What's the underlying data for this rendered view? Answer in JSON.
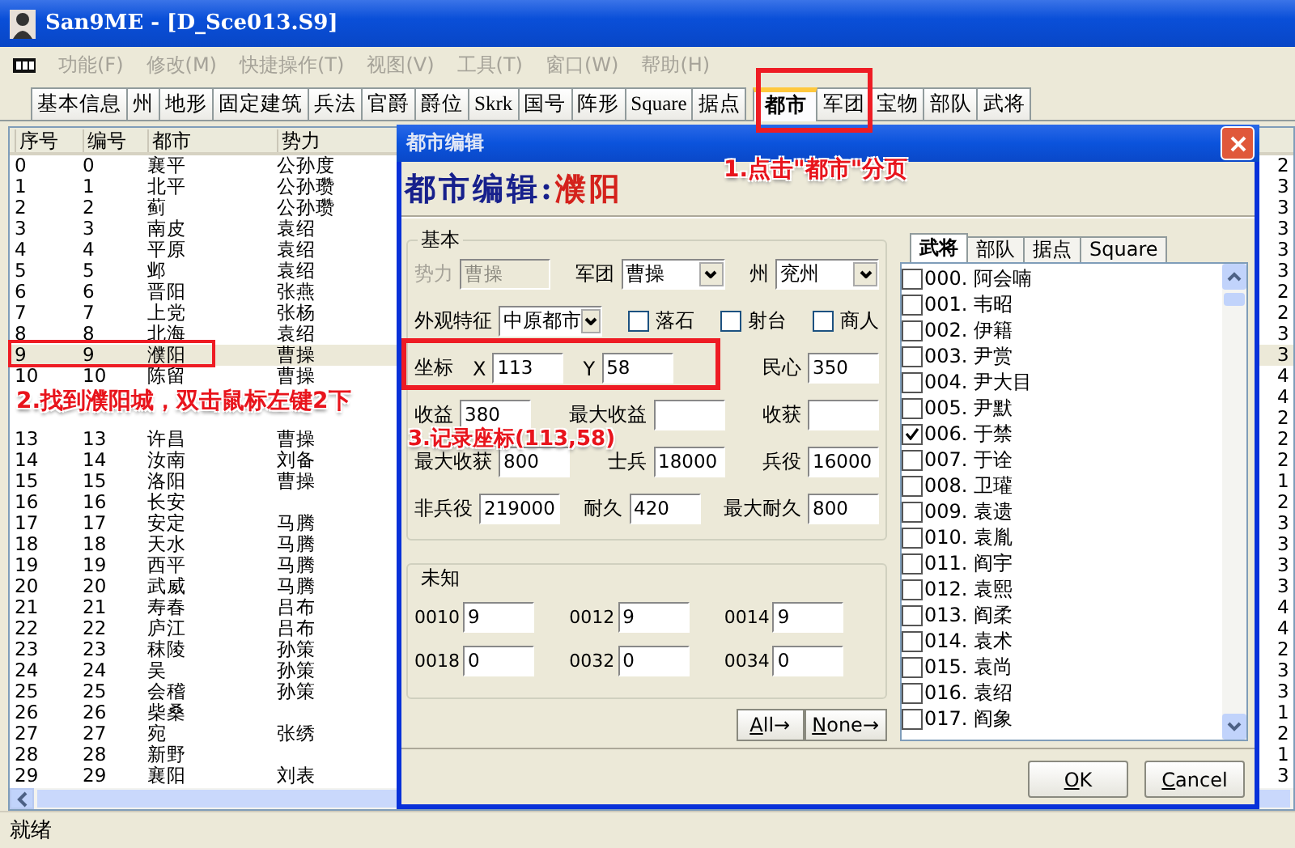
{
  "window": {
    "title": "San9ME - [D_Sce013.S9]"
  },
  "menu": [
    {
      "label": "功能(F)",
      "disabled": true
    },
    {
      "label": "修改(M)",
      "disabled": true
    },
    {
      "label": "快捷操作(T)",
      "disabled": true
    },
    {
      "label": "视图(V)",
      "disabled": true
    },
    {
      "label": "工具(T)",
      "disabled": true
    },
    {
      "label": "窗口(W)",
      "disabled": true
    },
    {
      "label": "帮助(H)",
      "disabled": true
    }
  ],
  "tabs": [
    {
      "label": "基本信息",
      "selected": false
    },
    {
      "label": "州",
      "selected": false
    },
    {
      "label": "地形",
      "selected": false
    },
    {
      "label": "固定建筑",
      "selected": false
    },
    {
      "label": "兵法",
      "selected": false
    },
    {
      "label": "官爵",
      "selected": false
    },
    {
      "label": "爵位",
      "selected": false
    },
    {
      "label": "Skrk",
      "selected": false
    },
    {
      "label": "国号",
      "selected": false
    },
    {
      "label": "阵形",
      "selected": false
    },
    {
      "label": "Square",
      "selected": false
    },
    {
      "label": "据点",
      "selected": false
    },
    {
      "label": "都市",
      "selected": true
    },
    {
      "label": "军团",
      "selected": false
    },
    {
      "label": "宝物",
      "selected": false
    },
    {
      "label": "部队",
      "selected": false
    },
    {
      "label": "武将",
      "selected": false
    }
  ],
  "city_list": {
    "columns": [
      "序号",
      "编号",
      "都市",
      "势力"
    ],
    "rows": [
      {
        "no": "0",
        "id": "0",
        "city": "襄平",
        "faction": "公孙度",
        "column_5": "2",
        "selected": false
      },
      {
        "no": "1",
        "id": "1",
        "city": "北平",
        "faction": "公孙瓒",
        "column_5": "3",
        "selected": false
      },
      {
        "no": "2",
        "id": "2",
        "city": "蓟",
        "faction": "公孙瓒",
        "column_5": "3",
        "selected": false
      },
      {
        "no": "3",
        "id": "3",
        "city": "南皮",
        "faction": "袁绍",
        "column_5": "3",
        "selected": false
      },
      {
        "no": "4",
        "id": "4",
        "city": "平原",
        "faction": "袁绍",
        "column_5": "3",
        "selected": false
      },
      {
        "no": "5",
        "id": "5",
        "city": "邺",
        "faction": "袁绍",
        "column_5": "3",
        "selected": false
      },
      {
        "no": "6",
        "id": "6",
        "city": "晋阳",
        "faction": "张燕",
        "column_5": "2",
        "selected": false
      },
      {
        "no": "7",
        "id": "7",
        "city": "上党",
        "faction": "张杨",
        "column_5": "2",
        "selected": false
      },
      {
        "no": "8",
        "id": "8",
        "city": "北海",
        "faction": "袁绍",
        "column_5": "3",
        "selected": false
      },
      {
        "no": "9",
        "id": "9",
        "city": "濮阳",
        "faction": "曹操",
        "column_5": "3",
        "selected": true
      },
      {
        "no": "10",
        "id": "10",
        "city": "陈留",
        "faction": "曹操",
        "column_5": "4",
        "selected": false
      },
      {
        "column_5": "4",
        "selected": false
      },
      {
        "column_5": "2",
        "selected": false
      },
      {
        "no": "13",
        "id": "13",
        "city": "许昌",
        "faction": "曹操",
        "column_5": "2",
        "selected": false
      },
      {
        "no": "14",
        "id": "14",
        "city": "汝南",
        "faction": "刘备",
        "column_5": "2",
        "selected": false
      },
      {
        "no": "15",
        "id": "15",
        "city": "洛阳",
        "faction": "曹操",
        "column_5": "1",
        "selected": false
      },
      {
        "no": "16",
        "id": "16",
        "city": "长安",
        "column_5": "2",
        "selected": false
      },
      {
        "no": "17",
        "id": "17",
        "city": "安定",
        "faction": "马腾",
        "column_5": "3",
        "selected": false
      },
      {
        "no": "18",
        "id": "18",
        "city": "天水",
        "faction": "马腾",
        "column_5": "3",
        "selected": false
      },
      {
        "no": "19",
        "id": "19",
        "city": "西平",
        "faction": "马腾",
        "column_5": "3",
        "selected": false
      },
      {
        "no": "20",
        "id": "20",
        "city": "武威",
        "faction": "马腾",
        "column_5": "3",
        "selected": false
      },
      {
        "no": "21",
        "id": "21",
        "city": "寿春",
        "faction": "吕布",
        "column_5": "4",
        "selected": false
      },
      {
        "no": "22",
        "id": "22",
        "city": "庐江",
        "faction": "吕布",
        "column_5": "4",
        "selected": false
      },
      {
        "no": "23",
        "id": "23",
        "city": "秣陵",
        "faction": "孙策",
        "column_5": "2",
        "selected": false
      },
      {
        "no": "24",
        "id": "24",
        "city": "吴",
        "faction": "孙策",
        "column_5": "3",
        "selected": false
      },
      {
        "no": "25",
        "id": "25",
        "city": "会稽",
        "faction": "孙策",
        "column_5": "3",
        "selected": false
      },
      {
        "no": "26",
        "id": "26",
        "city": "柴桑",
        "column_5": "1",
        "selected": false
      },
      {
        "no": "27",
        "id": "27",
        "city": "宛",
        "faction": "张绣",
        "column_5": "2",
        "selected": false
      },
      {
        "no": "28",
        "id": "28",
        "city": "新野",
        "column_5": "1",
        "selected": false
      },
      {
        "no": "29",
        "id": "29",
        "city": "襄阳",
        "faction": "刘表",
        "column_5": "3",
        "selected": false
      }
    ]
  },
  "dialog": {
    "title": "都市编辑",
    "heading": "都市编辑:",
    "city": "濮阳",
    "basic": {
      "title": "基本",
      "lines": [
        {
          "fields": [
            {
              "kind": "input",
              "label": "势力",
              "value": "曹操",
              "disabled": true
            },
            {
              "kind": "combo",
              "label": "军团",
              "value": "曹操",
              "disabled": false
            },
            {
              "kind": "combo",
              "label": "州",
              "value": "兖州",
              "disabled": false
            }
          ]
        },
        {
          "fields": [
            {
              "kind": "combo",
              "label": "外观特征",
              "value": "中原都市",
              "disabled": false
            },
            {
              "kind": "checkbox",
              "label": "落石",
              "checked": false
            },
            {
              "kind": "checkbox",
              "label": "射台",
              "checked": false
            },
            {
              "kind": "checkbox",
              "label": "商人",
              "checked": false
            }
          ]
        },
        {
          "fields": [
            {
              "kind": "caption",
              "label": "坐标"
            },
            {
              "kind": "input",
              "label": "X",
              "value": "113",
              "disabled": false
            },
            {
              "kind": "input",
              "label": "Y",
              "value": "58",
              "disabled": false
            },
            {
              "kind": "input",
              "label": "民心",
              "value": "350",
              "disabled": false
            }
          ]
        },
        {
          "fields": [
            {
              "kind": "input",
              "label": "收益",
              "value": "380",
              "disabled": false
            },
            {
              "kind": "input",
              "label": "最大收益",
              "disabled": false
            },
            {
              "kind": "input",
              "label": "收获",
              "disabled": false
            }
          ]
        },
        {
          "fields": [
            {
              "kind": "input",
              "label": "最大收获",
              "value": "800",
              "disabled": false
            },
            {
              "kind": "input",
              "label": "士兵",
              "value": "18000",
              "disabled": false
            },
            {
              "kind": "input",
              "label": "兵役",
              "value": "16000",
              "disabled": false
            }
          ]
        },
        {
          "fields": [
            {
              "kind": "input",
              "label": "非兵役",
              "value": "219000",
              "disabled": false
            },
            {
              "kind": "input",
              "label": "耐久",
              "value": "420",
              "disabled": false
            },
            {
              "kind": "input",
              "label": "最大耐久",
              "value": "800",
              "disabled": false
            }
          ]
        }
      ]
    },
    "unknown": {
      "title": "未知",
      "fields": [
        {
          "label": "0010",
          "value": "9"
        },
        {
          "label": "0012",
          "value": "9"
        },
        {
          "label": "0014",
          "value": "9"
        },
        {
          "label": "0018",
          "value": "0"
        },
        {
          "label": "0032",
          "value": "0"
        },
        {
          "label": "0034",
          "value": "0"
        }
      ]
    },
    "buttons": [
      "All→",
      "None→"
    ],
    "tabs": [
      {
        "label": "武将",
        "selected": true
      },
      {
        "label": "部队",
        "selected": false
      },
      {
        "label": "据点",
        "selected": false
      },
      {
        "label": "Square",
        "selected": false
      }
    ],
    "officers": [
      {
        "label": "000. 阿会喃",
        "checked": false
      },
      {
        "label": "001. 韦昭",
        "checked": false
      },
      {
        "label": "002. 伊籍",
        "checked": false
      },
      {
        "label": "003. 尹赏",
        "checked": false
      },
      {
        "label": "004. 尹大目",
        "checked": false
      },
      {
        "label": "005. 尹默",
        "checked": false
      },
      {
        "label": "006. 于禁",
        "checked": true
      },
      {
        "label": "007. 于诠",
        "checked": false
      },
      {
        "label": "008. 卫瓘",
        "checked": false
      },
      {
        "label": "009. 袁遗",
        "checked": false
      },
      {
        "label": "010. 袁胤",
        "checked": false
      },
      {
        "label": "011. 阎宇",
        "checked": false
      },
      {
        "label": "012. 袁熙",
        "checked": false
      },
      {
        "label": "013. 阎柔",
        "checked": false
      },
      {
        "label": "014. 袁术",
        "checked": false
      },
      {
        "label": "015. 袁尚",
        "checked": false
      },
      {
        "label": "016. 袁绍",
        "checked": false
      },
      {
        "label": "017. 阎象",
        "checked": false
      }
    ],
    "footer_buttons": [
      "OK",
      "Cancel"
    ]
  },
  "annotations": [
    "1.点击\"都市\"分页",
    "2.找到濮阳城，双击鼠标左键2下",
    "3.记录座标(113,58)"
  ],
  "status_bar": "就绪"
}
